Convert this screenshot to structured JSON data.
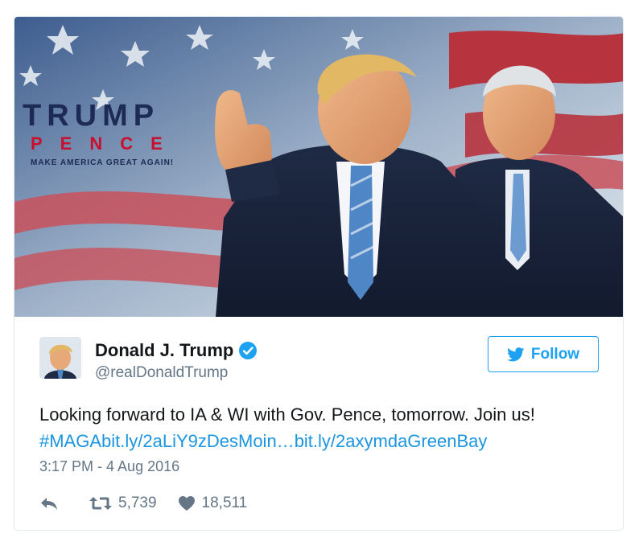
{
  "author": {
    "name": "Donald J. Trump",
    "handle": "@realDonaldTrump"
  },
  "follow_label": "Follow",
  "media": {
    "logo_line1": "TRUMP",
    "logo_line2": "PENCE",
    "logo_tagline": "MAKE AMERICA GREAT AGAIN!"
  },
  "tweet": {
    "text": "Looking forward to IA & WI with Gov. Pence, tomorrow. Join us!",
    "link1": "#MAGAbit.ly/2aLiY9zDesMoin…",
    "link2": "bit.ly/2axymdaGreenBay",
    "timestamp": "3:17 PM - 4 Aug 2016"
  },
  "stats": {
    "retweets": "5,739",
    "likes": "18,511"
  },
  "colors": {
    "accent": "#1da1f2",
    "link": "#1b95e0",
    "muted": "#657786",
    "text": "#14171a",
    "logo_navy": "#1c2a54",
    "logo_red": "#c8102e"
  },
  "icons": [
    "verified-badge-icon",
    "bird-icon",
    "reply-icon",
    "retweet-icon",
    "heart-icon"
  ]
}
